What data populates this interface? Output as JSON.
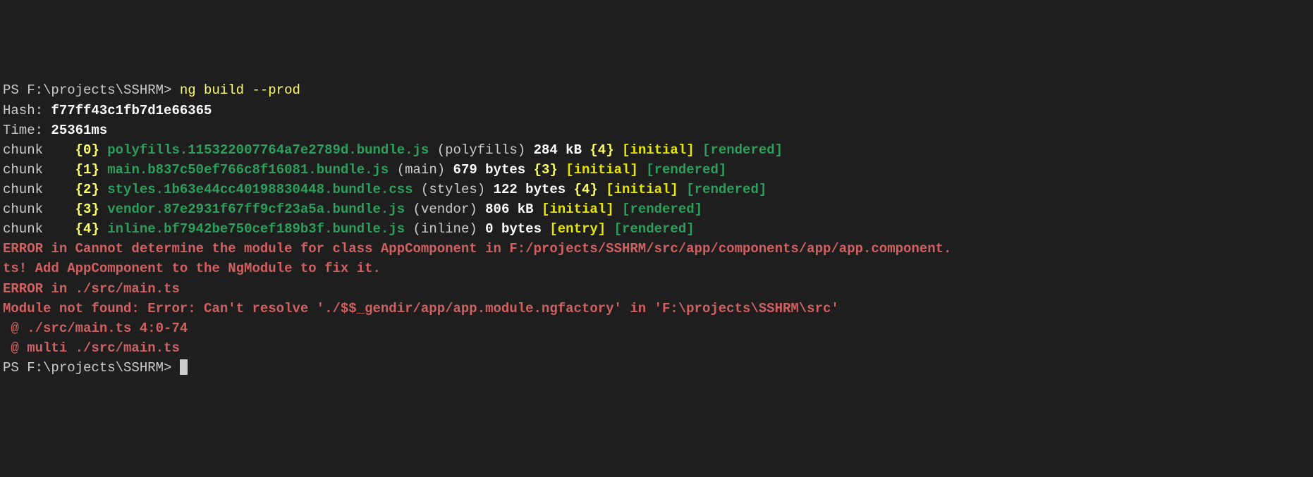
{
  "prompt1_prefix": "PS F:\\projects\\SSHRM> ",
  "command": "ng build --prod",
  "hash_label": "Hash: ",
  "hash_value": "f77ff43c1fb7d1e66365",
  "time_label": "Time: ",
  "time_value": "25361ms",
  "chunks": [
    {
      "label": "chunk    ",
      "obr": "{",
      "idx": "0",
      "cbr": "}",
      "sp": " ",
      "file": "polyfills.115322007764a7e2789d.bundle.js",
      "group": " (polyfills) ",
      "size": "284 kB ",
      "par_o": "{",
      "par_i": "4",
      "par_c": "}",
      "flag1": " [initial]",
      "flag2": " [rendered]"
    },
    {
      "label": "chunk    ",
      "obr": "{",
      "idx": "1",
      "cbr": "}",
      "sp": " ",
      "file": "main.b837c50ef766c8f16081.bundle.js",
      "group": " (main) ",
      "size": "679 bytes ",
      "par_o": "{",
      "par_i": "3",
      "par_c": "}",
      "flag1": " [initial]",
      "flag2": " [rendered]"
    },
    {
      "label": "chunk    ",
      "obr": "{",
      "idx": "2",
      "cbr": "}",
      "sp": " ",
      "file": "styles.1b63e44cc40198830448.bundle.css",
      "group": " (styles) ",
      "size": "122 bytes ",
      "par_o": "{",
      "par_i": "4",
      "par_c": "}",
      "flag1": " [initial]",
      "flag2": " [rendered]"
    },
    {
      "label": "chunk    ",
      "obr": "{",
      "idx": "3",
      "cbr": "}",
      "sp": " ",
      "file": "vendor.87e2931f67ff9cf23a5a.bundle.js",
      "group": " (vendor) ",
      "size": "806 kB ",
      "par_o": "",
      "par_i": "",
      "par_c": "",
      "flag1": "[initial]",
      "flag2": " [rendered]"
    },
    {
      "label": "chunk    ",
      "obr": "{",
      "idx": "4",
      "cbr": "}",
      "sp": " ",
      "file": "inline.bf7942be750cef189b3f.bundle.js",
      "group": " (inline) ",
      "size": "0 bytes ",
      "par_o": "",
      "par_i": "",
      "par_c": "",
      "flag1": "[entry]",
      "flag2": " [rendered]"
    }
  ],
  "blank1": "",
  "error1_line1": "ERROR in Cannot determine the module for class AppComponent in F:/projects/SSHRM/src/app/components/app/app.component.",
  "error1_line2": "ts! Add AppComponent to the NgModule to fix it.",
  "blank2": "",
  "error2_line1": "ERROR in ./src/main.ts",
  "error2_line2": "Module not found: Error: Can't resolve './$$_gendir/app/app.module.ngfactory' in 'F:\\projects\\SSHRM\\src'",
  "error2_line3": " @ ./src/main.ts 4:0-74",
  "error2_line4": " @ multi ./src/main.ts",
  "prompt2_prefix": "PS F:\\projects\\SSHRM> "
}
